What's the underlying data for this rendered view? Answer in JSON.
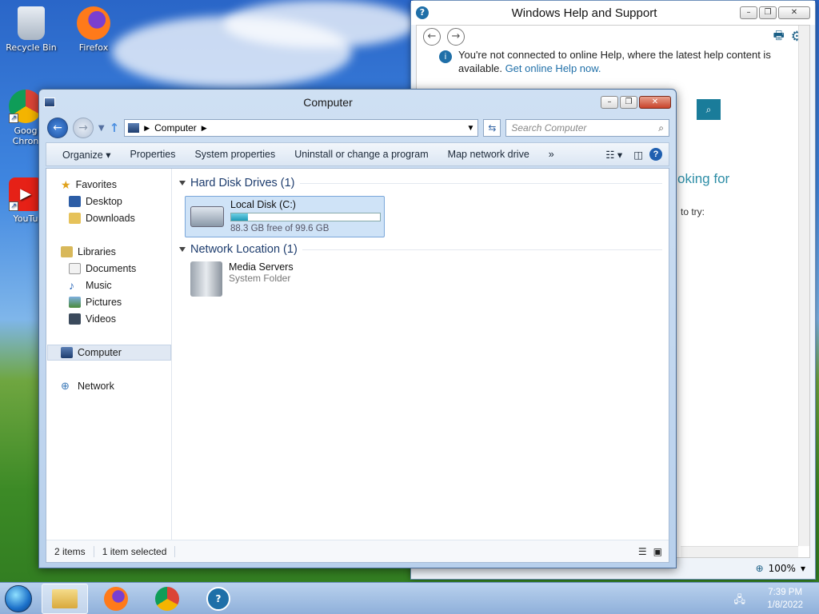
{
  "desktop": {
    "icons": [
      {
        "label": "Recycle Bin"
      },
      {
        "label": "Firefox"
      },
      {
        "label": "Goog Chron"
      },
      {
        "label": "YouTu"
      }
    ]
  },
  "help_window": {
    "title": "Windows Help and Support",
    "notice_text": "You're not connected to online Help, where the latest help content is available.",
    "notice_link": "Get online Help now.",
    "partial_heading": "oking for",
    "partial_text": "to try:",
    "zoom": "100%"
  },
  "explorer": {
    "title": "Computer",
    "address": "Computer",
    "search_placeholder": "Search Computer",
    "toolbar": {
      "organize": "Organize",
      "properties": "Properties",
      "system_properties": "System properties",
      "uninstall": "Uninstall or change a program",
      "map_drive": "Map network drive",
      "more": "»"
    },
    "nav": {
      "favorites": "Favorites",
      "desktop": "Desktop",
      "downloads": "Downloads",
      "libraries": "Libraries",
      "documents": "Documents",
      "music": "Music",
      "pictures": "Pictures",
      "videos": "Videos",
      "computer": "Computer",
      "network": "Network"
    },
    "groups": {
      "hard_disks": "Hard Disk Drives (1)",
      "network_location": "Network Location (1)"
    },
    "drive": {
      "name": "Local Disk (C:)",
      "free_text": "88.3 GB free of 99.6 GB",
      "used_fraction": 0.113
    },
    "network_item": {
      "name": "Media Servers",
      "type": "System Folder"
    },
    "status": {
      "items": "2 items",
      "selected": "1 item selected"
    }
  },
  "taskbar": {
    "time": "7:39 PM",
    "date": "1/8/2022"
  },
  "colors": {
    "accent": "#1f6fa8",
    "selection": "#cfe3f7",
    "group_header": "#1e3d6e"
  }
}
